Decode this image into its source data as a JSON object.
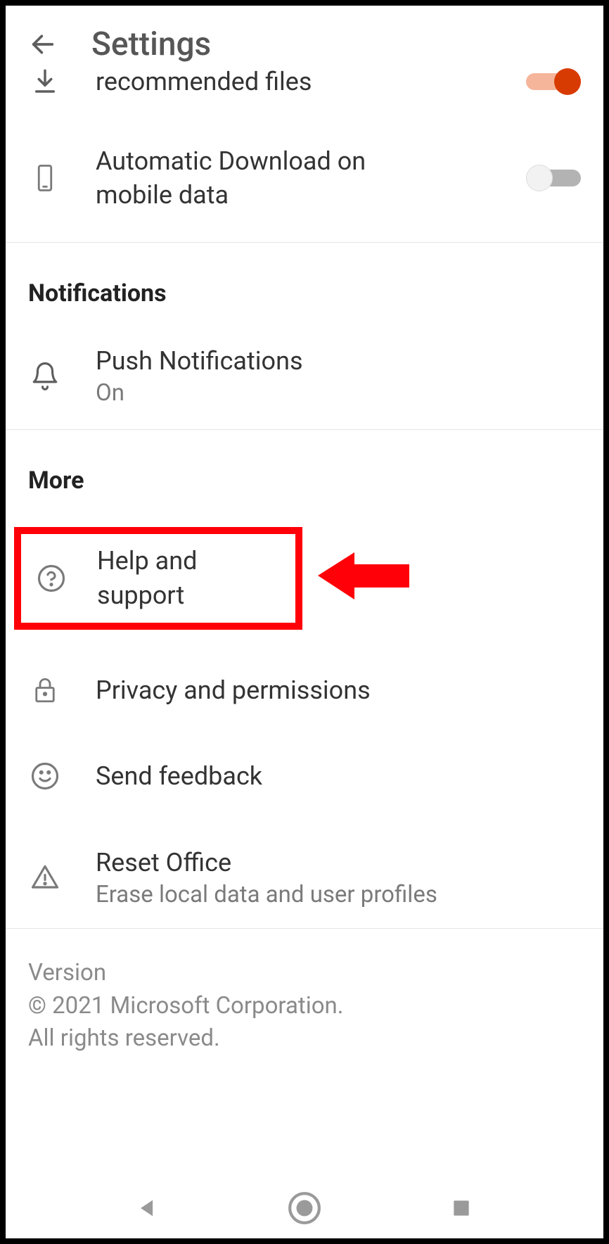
{
  "header": {
    "title": "Settings"
  },
  "items": {
    "download_recent": {
      "title_line2": "recommended files",
      "toggle": "on"
    },
    "auto_download": {
      "title": "Automatic Download on mobile data",
      "toggle": "off"
    },
    "push_notifications": {
      "title": "Push Notifications",
      "sub": "On"
    },
    "help_support": {
      "title": "Help and support"
    },
    "privacy": {
      "title": "Privacy and permissions"
    },
    "feedback": {
      "title": "Send feedback"
    },
    "reset": {
      "title": "Reset Office",
      "sub": "Erase local data and user profiles"
    }
  },
  "sections": {
    "notifications": "Notifications",
    "more": "More"
  },
  "footer": {
    "version": "Version",
    "copyright": "© 2021 Microsoft Corporation.",
    "rights": "All rights reserved."
  }
}
